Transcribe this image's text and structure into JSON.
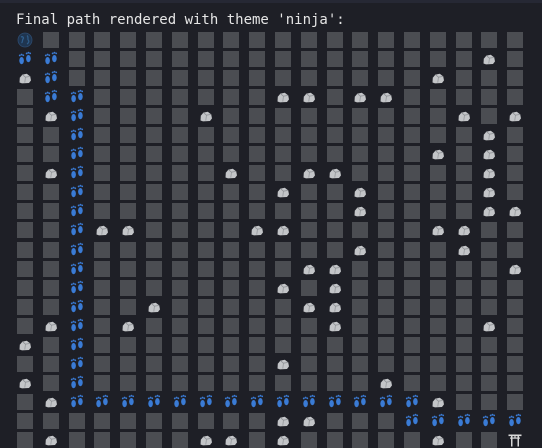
{
  "terminal": {
    "heading": "Final path rendered with theme 'ninja':"
  },
  "legend": {
    "start": "globe-icon",
    "path": "footprints-icon",
    "obstacle": "rock-icon",
    "goal": "torii-gate-icon",
    "empty": "square-tile"
  },
  "grid": {
    "columns": 20,
    "rows": [
      "S...................",
      "ff................R.",
      "Rf..............R...",
      ".ff.......RR.RR.....",
      ".Rf....R.........R.R",
      "..f...............R.",
      "..f.............R.R.",
      ".Rf.....R..RR.....R.",
      "..f.......R..R....R.",
      "..f..........R....RR",
      "..fRR....RR.....RR..",
      "..f..........R...R..",
      "..f........RR......R",
      "..f.......R.R.......",
      "..f..R.....RR.......",
      ".Rf.R.......R.....R.",
      "R.f.................",
      "..f.......R.........",
      "R.f...........R.....",
      ".Rffffffffffffffr...",
      "..........RR...fffff",
      ".R.....RR.R.....R..G"
    ]
  }
}
